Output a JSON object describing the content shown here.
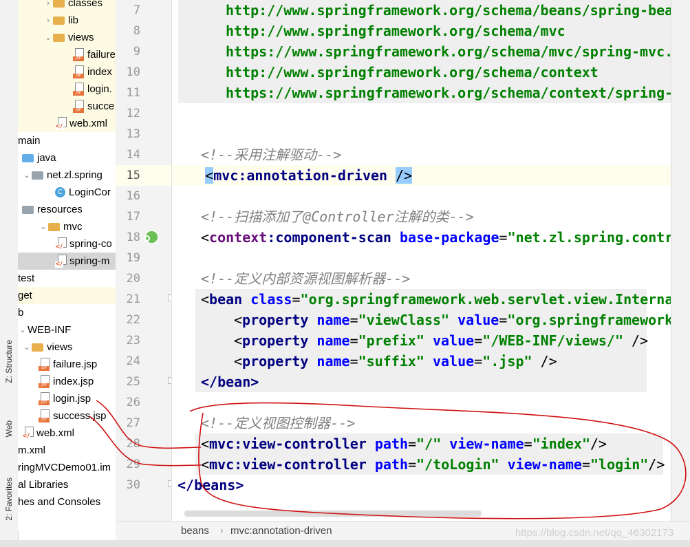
{
  "tree": {
    "rows": [
      {
        "label": "classes",
        "icon": "folder-icon",
        "arrow": "›"
      },
      {
        "label": "lib",
        "icon": "folder-icon",
        "arrow": "›"
      },
      {
        "label": "views",
        "icon": "folder-icon",
        "arrow": "⌄"
      },
      {
        "label": "failure",
        "icon": "jsp-file-icon"
      },
      {
        "label": "index",
        "icon": "jsp-file-icon"
      },
      {
        "label": "login.",
        "icon": "jsp-file-icon"
      },
      {
        "label": "succe",
        "icon": "jsp-file-icon"
      },
      {
        "label": "web.xml",
        "icon": "xml-file-icon"
      },
      {
        "label": "main"
      },
      {
        "label": "java",
        "icon": "source-folder-icon"
      },
      {
        "label": "net.zl.spring",
        "icon": "package-icon",
        "arrow": "⌄"
      },
      {
        "label": "LoginCor",
        "icon": "class-icon"
      },
      {
        "label": "resources",
        "icon": "resources-folder-icon"
      },
      {
        "label": "mvc",
        "icon": "folder-icon",
        "arrow": "⌄"
      },
      {
        "label": "spring-co",
        "icon": "xml-file-icon"
      },
      {
        "label": "spring-m",
        "icon": "xml-file-icon"
      },
      {
        "label": "test"
      },
      {
        "label": "get"
      },
      {
        "label": "b"
      },
      {
        "label": "WEB-INF",
        "arrow": "⌄"
      },
      {
        "label": "views",
        "icon": "folder-icon",
        "arrow": "⌄"
      },
      {
        "label": "failure.jsp",
        "icon": "jsp-file-icon"
      },
      {
        "label": "index.jsp",
        "icon": "jsp-file-icon"
      },
      {
        "label": "login.jsp",
        "icon": "jsp-file-icon"
      },
      {
        "label": "success.jsp",
        "icon": "jsp-file-icon"
      },
      {
        "label": "web.xml",
        "icon": "xml-file-icon"
      },
      {
        "label": "m.xml"
      },
      {
        "label": "ringMVCDemo01.im"
      },
      {
        "label": "al Libraries"
      },
      {
        "label": "hes and Consoles"
      }
    ]
  },
  "toolstrip": {
    "structure": "Z: Structure",
    "web": "Web",
    "favorites": "2: Favorites"
  },
  "editor": {
    "line_numbers": [
      "7",
      "8",
      "9",
      "10",
      "11",
      "12",
      "13",
      "14",
      "15",
      "16",
      "17",
      "18",
      "19",
      "20",
      "21",
      "22",
      "23",
      "24",
      "25",
      "26",
      "27",
      "28",
      "29",
      "30"
    ],
    "l7": "http://www.springframework.org/schema/beans/spring-bea",
    "l8": "http://www.springframework.org/schema/mvc",
    "l9": "https://www.springframework.org/schema/mvc/spring-mvc.",
    "l10": "http://www.springframework.org/schema/context",
    "l11": "https://www.springframework.org/schema/context/spring-",
    "c14": "<!--采用注解驱动-->",
    "c17": "<!--扫描添加了@Controller注解的类-->",
    "c20": "<!--定义内部资源视图解析器-->",
    "c27": "<!--定义视图控制器-->",
    "lt": "<",
    "gt": ">",
    "sc": "/>",
    "eq": "=",
    "mvc": "mvc",
    "context": "context",
    "colon": ":",
    "annotation_driven": "annotation-driven",
    "component_scan": "component-scan",
    "base_package": "base-package",
    "base_package_val": "\"net.zl.spring.contr",
    "bean": "bean",
    "class_attr": "class",
    "class_val": "\"org.springframework.web.servlet.view.Interna",
    "property": "property",
    "name_attr": "name",
    "value_attr": "value",
    "viewClass": "\"viewClass\"",
    "viewClass_val": "\"org.springframework",
    "prefix": "\"prefix\"",
    "prefix_val": "\"/WEB-INF/views/\"",
    "suffix": "\"suffix\"",
    "suffix_val": "\".jsp\"",
    "end_bean": "</bean>",
    "view_controller": "view-controller",
    "path_attr": "path",
    "view_name_attr": "view-name",
    "path1": "\"/\"",
    "vn1": "\"index\"",
    "path2": "\"/toLogin\"",
    "vn2": "\"login\"",
    "end_beans_open": "</",
    "beans": "beans"
  },
  "breadcrumbs": {
    "item1": "beans",
    "separator": "›",
    "item2": "mvc:annotation-driven"
  },
  "watermark": "https://blog.csdn.net/qq_46302173",
  "colors": {
    "tag": "#000080",
    "attribute": "#0000ff",
    "value": "#008000",
    "comment": "#808080",
    "namespace": "#660e7a",
    "annotation_ink": "#d01010"
  }
}
